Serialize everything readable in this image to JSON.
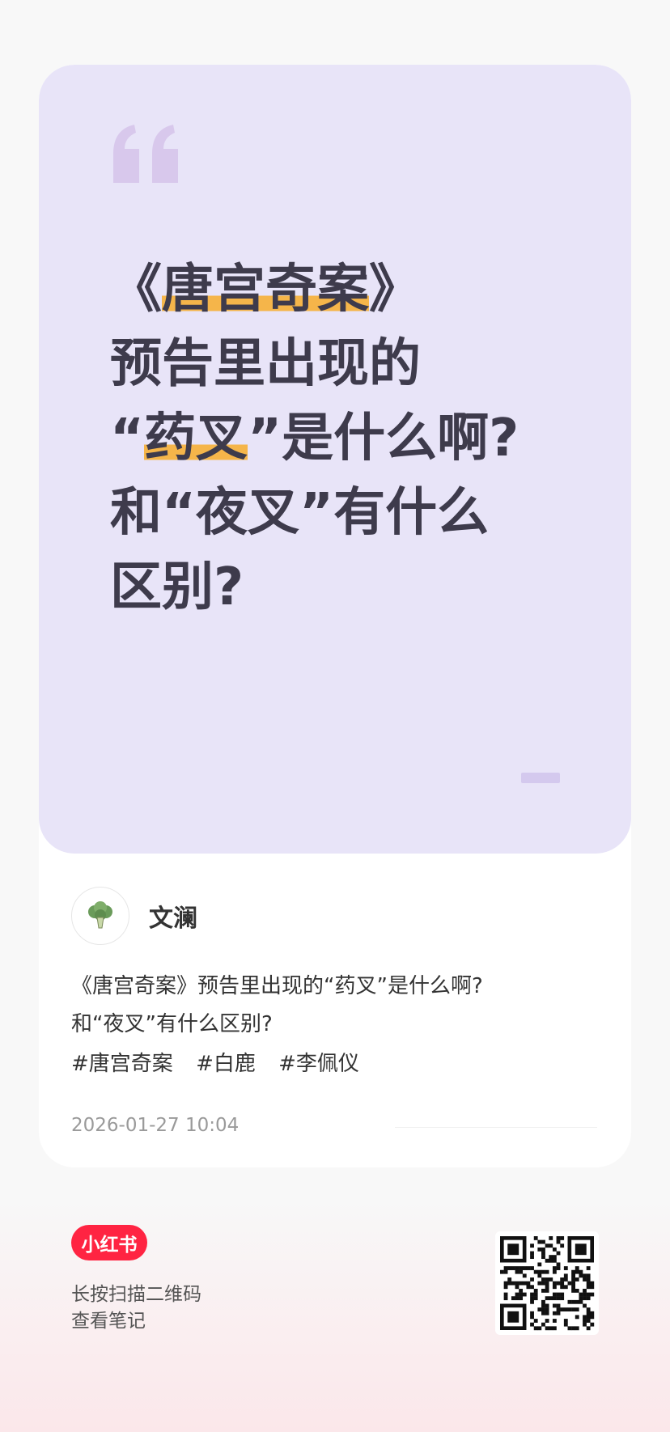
{
  "cover": {
    "headline_lines": [
      {
        "pre": "《",
        "hl": "唐宫奇案",
        "post": "》"
      },
      {
        "pre": "预告里出现的",
        "hl": "",
        "post": ""
      },
      {
        "pre": "“",
        "hl": "药叉",
        "post": "”是什么啊?"
      },
      {
        "pre": "和“夜叉”有什么",
        "hl": "",
        "post": ""
      },
      {
        "pre": "区别?",
        "hl": "",
        "post": ""
      }
    ],
    "bg_color": "#e8e4f8",
    "highlight_color": "#f5b54a"
  },
  "author": {
    "name": "文澜",
    "avatar_icon": "broccoli-icon"
  },
  "note": {
    "desc_lines": [
      "《唐宫奇案》预告里出现的“药叉”是什么啊?",
      "和“夜叉”有什么区别?"
    ],
    "tags": [
      "#唐宫奇案",
      "#白鹿",
      "#李佩仪"
    ],
    "time": "2026-01-27 10:04"
  },
  "footer": {
    "logo": "小红书",
    "scan_lines": [
      "长按扫描二维码",
      "查看笔记"
    ],
    "brand_color": "#ff2442"
  }
}
